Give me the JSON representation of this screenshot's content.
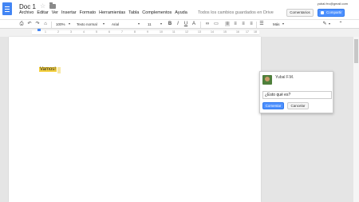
{
  "header": {
    "title": "Doc 1",
    "user_email": "yubal.fec@gmail.com",
    "comments_label": "Comentarios",
    "share_label": "Compartir"
  },
  "menu": {
    "items": [
      "Archivo",
      "Editar",
      "Ver",
      "Insertar",
      "Formato",
      "Herramientas",
      "Tabla",
      "Complementos",
      "Ayuda"
    ],
    "save_status": "Todos los cambios guardados en Drive"
  },
  "toolbar": {
    "zoom": "100%",
    "style": "Texto normal",
    "font": "Arial",
    "size": "11",
    "more": "Más"
  },
  "ruler": {
    "ticks": [
      "1",
      "2",
      "3",
      "4",
      "5",
      "6",
      "7",
      "8",
      "9",
      "10",
      "11",
      "12",
      "13",
      "14",
      "15",
      "16",
      "17",
      "18"
    ]
  },
  "document": {
    "text": "Vamos!"
  },
  "comment": {
    "user": "Yubal F.M.",
    "text": "¿Esto qué es?",
    "submit_label": "Comentar",
    "cancel_label": "Cancelar"
  },
  "colors": {
    "accent": "#4d90fe",
    "highlight": "#f4d03f",
    "logo": "#4285f4"
  }
}
